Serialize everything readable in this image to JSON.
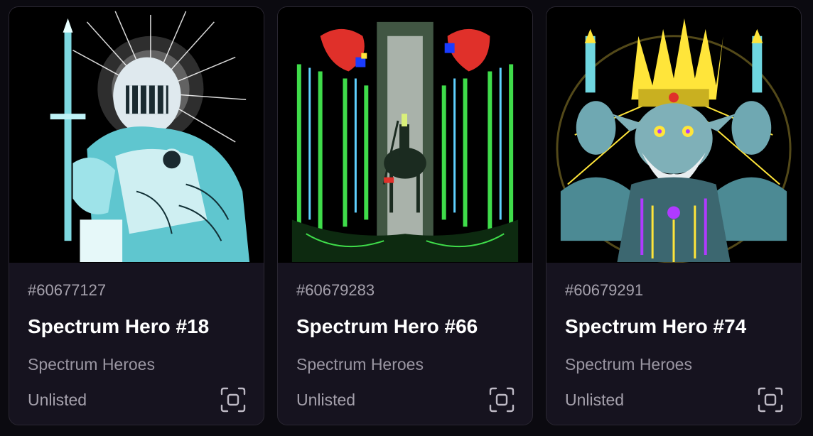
{
  "cards": [
    {
      "id": "#60677127",
      "title": "Spectrum Hero #18",
      "collection": "Spectrum Heroes",
      "status": "Unlisted",
      "scan_icon": "scan-icon"
    },
    {
      "id": "#60679283",
      "title": "Spectrum Hero #66",
      "collection": "Spectrum Heroes",
      "status": "Unlisted",
      "scan_icon": "scan-icon"
    },
    {
      "id": "#60679291",
      "title": "Spectrum Hero #74",
      "collection": "Spectrum Heroes",
      "status": "Unlisted",
      "scan_icon": "scan-icon"
    }
  ],
  "colors": {
    "card_bg": "#16131f",
    "page_bg": "#0b0a10",
    "title": "#ffffff",
    "muted": "#a5a1ac"
  }
}
